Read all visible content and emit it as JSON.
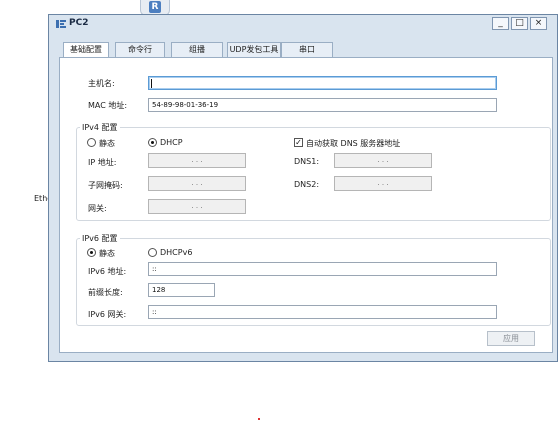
{
  "background": {
    "badge_letter": "R",
    "side_label": "Ethe"
  },
  "window": {
    "title": "PC2",
    "controls": {
      "minimize": "_",
      "maximize": "□",
      "close": "×"
    }
  },
  "tabs": [
    {
      "label": "基础配置",
      "active": true
    },
    {
      "label": "命令行",
      "active": false
    },
    {
      "label": "组播",
      "active": false
    },
    {
      "label": "UDP发包工具",
      "active": false
    },
    {
      "label": "串口",
      "active": false
    }
  ],
  "basic": {
    "hostname_label": "主机名:",
    "hostname_value": "",
    "mac_label": "MAC 地址:",
    "mac_value": "54-89-98-01-36-19"
  },
  "ipv4": {
    "legend": "IPv4 配置",
    "static_label": "静态",
    "dhcp_label": "DHCP",
    "mode": "DHCP",
    "auto_dns_label": "自动获取 DNS 服务器地址",
    "auto_dns_checked": true,
    "ip_label": "IP 地址:",
    "mask_label": "子网掩码:",
    "gateway_label": "网关:",
    "dns1_label": "DNS1:",
    "dns2_label": "DNS2:",
    "empty_ip": ".    .    ."
  },
  "ipv6": {
    "legend": "IPv6 配置",
    "static_label": "静态",
    "dhcp_label": "DHCPv6",
    "mode": "静态",
    "addr_label": "IPv6 地址:",
    "addr_value": "::",
    "prefix_label": "前缀长度:",
    "prefix_value": "128",
    "gateway_label": "IPv6 网关:",
    "gateway_value": "::"
  },
  "apply_label": "应用"
}
